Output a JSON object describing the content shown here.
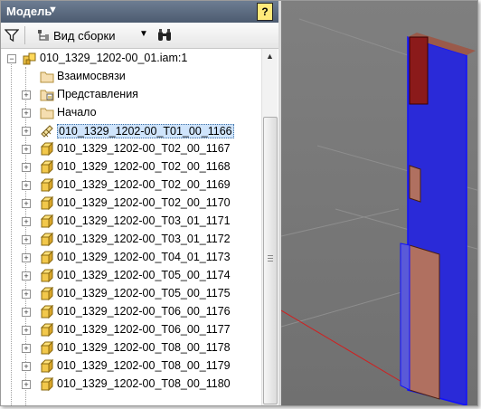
{
  "panel": {
    "title": "Модель",
    "help_label": "?"
  },
  "toolbar": {
    "view_label": "Вид сборки"
  },
  "icons": {
    "filter": "filter-icon",
    "view": "assembly-view-icon",
    "dropdown": "chevron-down-icon",
    "find": "binoculars-icon",
    "assembly": "assembly-icon",
    "folder": "folder-icon",
    "part": "part-icon"
  },
  "colors": {
    "title_bar": "#5b6b80",
    "selection": "#cfe4fb",
    "viewport_bg": "#7a7a7a",
    "part_blue": "#2a2ad8",
    "part_face": "#b07060"
  },
  "tree": {
    "root": "010_1329_1202-00_01.iam:1",
    "folders": [
      "Взаимосвязи",
      "Представления",
      "Начало"
    ],
    "parts": [
      "010_1329_1202-00_T01_00_1166",
      "010_1329_1202-00_T02_00_1167",
      "010_1329_1202-00_T02_00_1168",
      "010_1329_1202-00_T02_00_1169",
      "010_1329_1202-00_T02_00_1170",
      "010_1329_1202-00_T03_01_1171",
      "010_1329_1202-00_T03_01_1172",
      "010_1329_1202-00_T04_01_1173",
      "010_1329_1202-00_T05_00_1174",
      "010_1329_1202-00_T05_00_1175",
      "010_1329_1202-00_T06_00_1176",
      "010_1329_1202-00_T06_00_1177",
      "010_1329_1202-00_T08_00_1178",
      "010_1329_1202-00_T08_00_1179",
      "010_1329_1202-00_T08_00_1180"
    ]
  }
}
